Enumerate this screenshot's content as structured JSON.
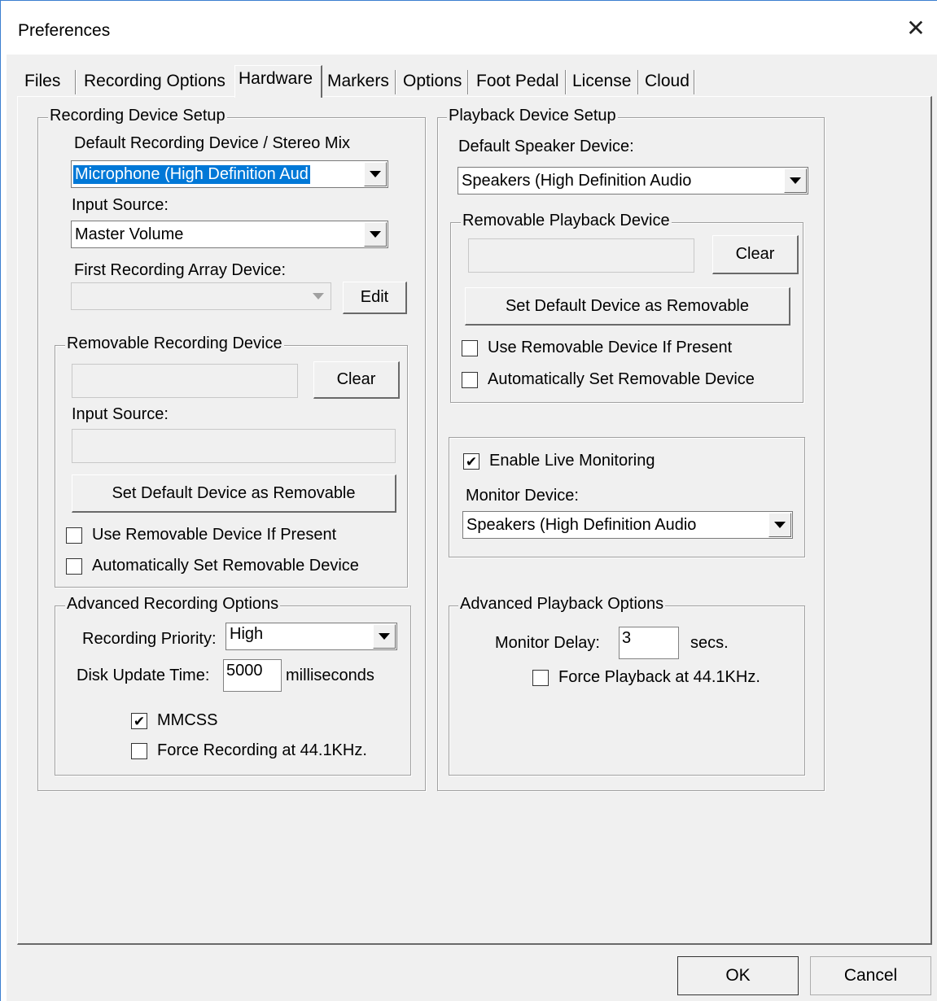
{
  "window": {
    "title": "Preferences"
  },
  "tabs": [
    "Files",
    "Recording Options",
    "Hardware",
    "Markers",
    "Options",
    "Foot Pedal",
    "License",
    "Cloud"
  ],
  "active_tab": "Hardware",
  "recording_setup": {
    "legend": "Recording Device Setup",
    "default_device_label": "Default Recording Device / Stereo Mix",
    "default_device_value": "Microphone (High Definition Aud",
    "input_source_label": "Input Source:",
    "input_source_value": "Master Volume",
    "array_device_label": "First Recording Array Device:",
    "array_device_value": "",
    "edit_button": "Edit"
  },
  "removable_recording": {
    "legend": "Removable Recording Device",
    "device_value": "",
    "clear_button": "Clear",
    "input_source_label": "Input Source:",
    "input_source_value": "",
    "set_default_button": "Set Default Device as Removable",
    "use_removable_label": "Use Removable Device If Present",
    "use_removable_checked": false,
    "auto_set_label": "Automatically Set Removable Device",
    "auto_set_checked": false
  },
  "advanced_recording": {
    "legend": "Advanced Recording Options",
    "priority_label": "Recording Priority:",
    "priority_value": "High",
    "disk_update_label": "Disk Update Time:",
    "disk_update_value": "5000",
    "disk_update_unit": "milliseconds",
    "mmcss_label": "MMCSS",
    "mmcss_checked": true,
    "force_recording_label": "Force Recording at 44.1KHz.",
    "force_recording_checked": false
  },
  "playback_setup": {
    "legend": "Playback Device Setup",
    "speaker_label": "Default Speaker Device:",
    "speaker_value": "Speakers (High Definition Audio"
  },
  "removable_playback": {
    "legend": "Removable Playback Device",
    "device_value": "",
    "clear_button": "Clear",
    "set_default_button": "Set Default Device as Removable",
    "use_removable_label": "Use Removable Device If Present",
    "use_removable_checked": false,
    "auto_set_label": "Automatically Set Removable Device",
    "auto_set_checked": false
  },
  "live_monitoring": {
    "enable_label": "Enable Live Monitoring",
    "enable_checked": true,
    "monitor_device_label": "Monitor Device:",
    "monitor_device_value": "Speakers (High Definition Audio"
  },
  "advanced_playback": {
    "legend": "Advanced Playback Options",
    "delay_label": "Monitor Delay:",
    "delay_value": "3",
    "delay_unit": "secs.",
    "force_playback_label": "Force Playback at 44.1KHz.",
    "force_playback_checked": false
  },
  "footer": {
    "ok_button": "OK",
    "cancel_button": "Cancel"
  },
  "colors": {
    "selection": "#0078d7",
    "dialog_bg": "#f0f0f0",
    "window_border": "#3b7fd0"
  }
}
